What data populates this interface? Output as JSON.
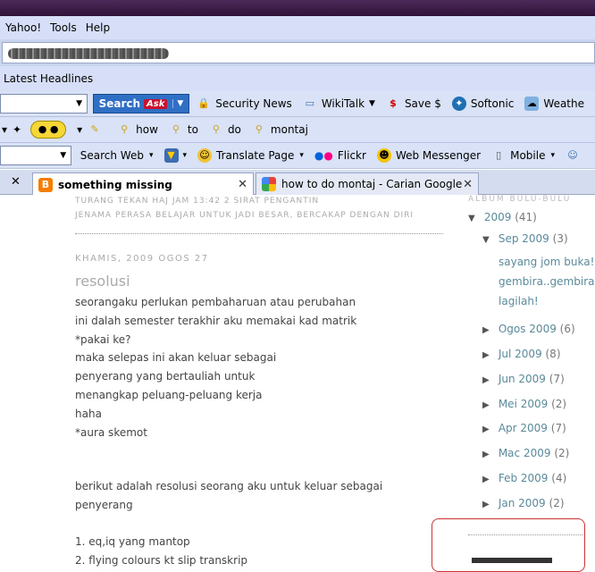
{
  "menu": [
    "Yahoo!",
    "Tools",
    "Help"
  ],
  "headlines_label": "Latest Headlines",
  "toolbar1": {
    "search_button": "Search",
    "ask_logo": "Ask",
    "items": [
      "Security News",
      "WikiTalk",
      "Save $",
      "Softonic",
      "Weathe"
    ]
  },
  "toolbar2": {
    "words": [
      "how",
      "to",
      "do",
      "montaj"
    ]
  },
  "toolbar3": {
    "items": [
      "Search Web",
      "Translate Page",
      "Flickr",
      "Web Messenger",
      "Mobile"
    ]
  },
  "tabs": [
    {
      "title": "something missing",
      "active": true
    },
    {
      "title": "how to do montaj - Carian Google",
      "active": false
    }
  ],
  "post": {
    "meta_line1": "TURANG TEKAN HAJ JAM 13:42  2 SIRAT PENGANTIN",
    "meta_line2": "JENAMA PERASA BELAJAR UNTUK JADI BESAR, BERCAKAP DENGAN DIRI",
    "date": "KHAMIS, 2009 OGOS 27",
    "title": "resolusi",
    "lines": [
      "seorangaku perlukan pembaharuan atau perubahan",
      "ini dalah semester terakhir aku memakai kad matrik",
      "*pakai ke?",
      "maka selepas ini akan keluar sebagai",
      "penyerang yang bertauliah untuk",
      "menangkap peluang-peluang kerja",
      "haha",
      "*aura skemot"
    ],
    "lines2": [
      "berikut adalah resolusi seorang aku untuk keluar sebagai penyerang"
    ],
    "lines3": [
      "1. eq,iq yang mantop",
      "2. flying colours kt slip transkrip"
    ]
  },
  "sidebar": {
    "header": "ALBUM BULU-BULU",
    "year": "2009",
    "year_count": "(41)",
    "current_month": "Sep 2009",
    "current_count": "(3)",
    "recent_posts": [
      "sayang jom buka!",
      "gembira..gembira",
      "lagilah!"
    ],
    "months": [
      {
        "label": "Ogos 2009",
        "count": "(6)"
      },
      {
        "label": "Jul 2009",
        "count": "(8)"
      },
      {
        "label": "Jun 2009",
        "count": "(7)"
      },
      {
        "label": "Mei 2009",
        "count": "(2)"
      },
      {
        "label": "Apr 2009",
        "count": "(7)"
      },
      {
        "label": "Mac 2009",
        "count": "(2)"
      },
      {
        "label": "Feb 2009",
        "count": "(4)"
      },
      {
        "label": "Jan 2009",
        "count": "(2)"
      }
    ]
  },
  "colors": {
    "accent_blue": "#2f6fc4",
    "link_teal": "#5a8a9a",
    "box_red": "#cc3333"
  }
}
